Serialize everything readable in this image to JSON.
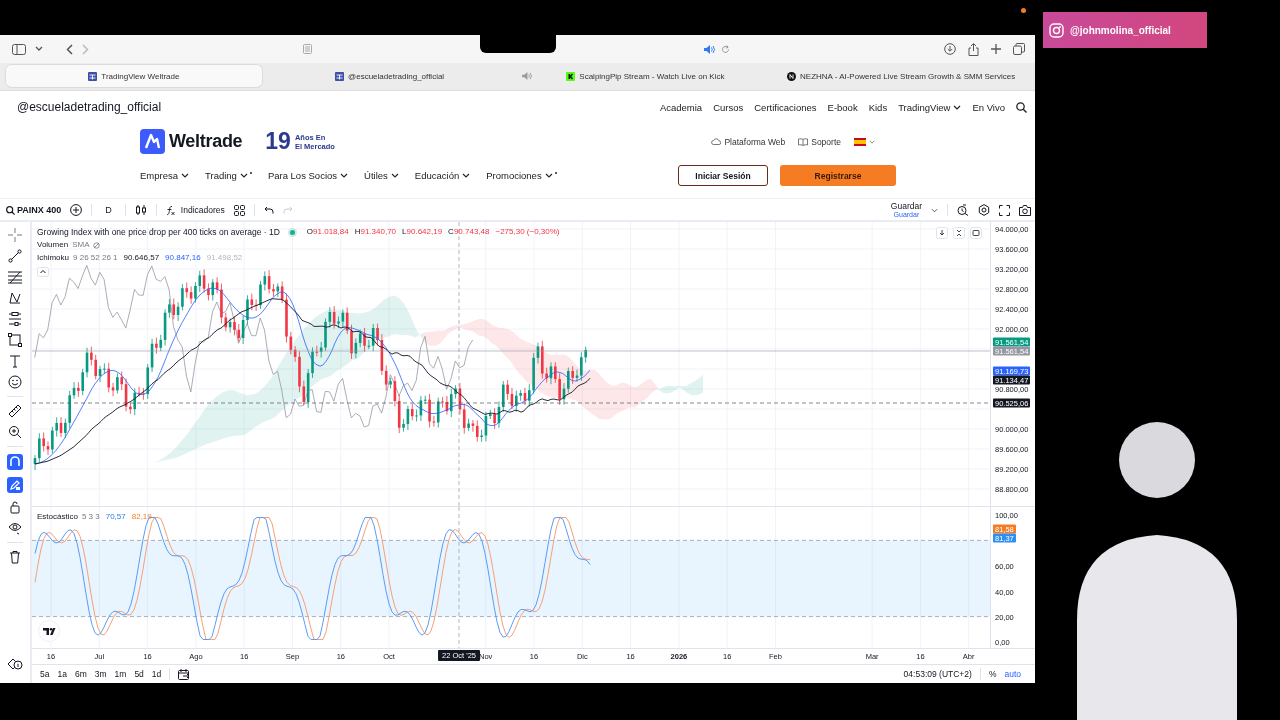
{
  "browser": {
    "tabs": [
      {
        "label": "TradingView Weltrade",
        "selected": true,
        "playing_audio": false
      },
      {
        "label": "@escueladetrading_official",
        "selected": false,
        "playing_audio": false
      },
      {
        "label": "ScalpingPip Stream - Watch Live on Kick",
        "selected": false,
        "playing_audio": true
      },
      {
        "label": "NEZHNA - AI-Powered Live Stream Growth & SMM Services",
        "selected": false,
        "playing_audio": false
      }
    ]
  },
  "site": {
    "handle": "@escueladetrading_official",
    "nav": [
      {
        "label": "Academia",
        "dropdown": false
      },
      {
        "label": "Cursos",
        "dropdown": false
      },
      {
        "label": "Certificaciones",
        "dropdown": false
      },
      {
        "label": "E-book",
        "dropdown": false
      },
      {
        "label": "Kids",
        "dropdown": false
      },
      {
        "label": "TradingView",
        "dropdown": true
      },
      {
        "label": "En Vivo",
        "dropdown": false
      }
    ],
    "brand": "Weltrade",
    "years": "19",
    "years_caption": [
      "Años En",
      "El Mercado"
    ],
    "links": [
      "Plataforma Web",
      "Soporte"
    ],
    "menu": [
      {
        "label": "Empresa",
        "dot": false
      },
      {
        "label": "Trading",
        "dot": true
      },
      {
        "label": "Para Los Socios",
        "dot": false
      },
      {
        "label": "Útiles",
        "dot": false
      },
      {
        "label": "Educación",
        "dot": false
      },
      {
        "label": "Promociones",
        "dot": true
      }
    ],
    "login": "Iniciar Sesión",
    "register": "Registrarse"
  },
  "chart": {
    "symbol": "PAINX 400",
    "interval": "D",
    "indicators": "Indicadores",
    "save": "Guardar",
    "save_caption": "Guardar",
    "title": "Growing Index with one price drop per 400 ticks on average · 1D",
    "ohlc": [
      {
        "label": "O",
        "value": "91.018,84"
      },
      {
        "label": "H",
        "value": "91.340,70"
      },
      {
        "label": "L",
        "value": "90.642,19"
      },
      {
        "label": "C",
        "value": "90.743,48"
      }
    ],
    "change": "−275,30 (−0,30%)",
    "volume": {
      "name": "Volumen",
      "param": "SMA"
    },
    "ichimoku": {
      "name": "Ichimoku",
      "params": "9 26 52 26 1",
      "values": [
        "90.646,57",
        "90.847,16",
        "91.498,52"
      ]
    },
    "price_axis": [
      {
        "kind": "tick",
        "text": "94.000,00"
      },
      {
        "kind": "tick",
        "text": "93.600,00"
      },
      {
        "kind": "tick",
        "text": "93.200,00"
      },
      {
        "kind": "tick",
        "text": "92.800,00"
      },
      {
        "kind": "tick",
        "text": "92.400,00"
      },
      {
        "kind": "tick",
        "text": "92.000,00"
      },
      {
        "kind": "label",
        "text": "91.561,54",
        "color": "#089981"
      },
      {
        "kind": "label",
        "text": "91.561,54",
        "color": "#9598a1"
      },
      {
        "kind": "label",
        "text": "91.169,73",
        "color": "#2962ff"
      },
      {
        "kind": "label",
        "text": "91.134,47",
        "color": "#131722"
      },
      {
        "kind": "tick",
        "text": "90.800,00"
      },
      {
        "kind": "label",
        "text": "90.525,06",
        "color": "#131722"
      },
      {
        "kind": "tick",
        "text": "90.000,00"
      },
      {
        "kind": "tick",
        "text": "89.600,00"
      },
      {
        "kind": "tick",
        "text": "89.200,00"
      },
      {
        "kind": "tick",
        "text": "88.800,00"
      }
    ],
    "stochastic": {
      "name": "Estocástico",
      "params": "5 3 3",
      "values": [
        "70,57",
        "82,19"
      ]
    },
    "stoch_axis": [
      {
        "kind": "tick",
        "text": "100,00"
      },
      {
        "kind": "label",
        "text": "81,58",
        "color": "#f57c22"
      },
      {
        "kind": "label",
        "text": "81,37",
        "color": "#2f8ff0"
      },
      {
        "kind": "tick",
        "text": "60,00"
      },
      {
        "kind": "tick",
        "text": "40,00"
      },
      {
        "kind": "tick",
        "text": "20,00"
      },
      {
        "kind": "tick",
        "text": "0,00"
      }
    ],
    "time_axis": [
      {
        "label": "16",
        "bold": false
      },
      {
        "label": "Jul",
        "bold": false
      },
      {
        "label": "16",
        "bold": false
      },
      {
        "label": "Ago",
        "bold": false
      },
      {
        "label": "16",
        "bold": false
      },
      {
        "label": "Sep",
        "bold": false
      },
      {
        "label": "16",
        "bold": false
      },
      {
        "label": "Oct",
        "bold": false
      },
      {
        "label": "Nov",
        "bold": false
      },
      {
        "label": "16",
        "bold": false
      },
      {
        "label": "Dic",
        "bold": false
      },
      {
        "label": "16",
        "bold": false
      },
      {
        "label": "2026",
        "bold": true
      },
      {
        "label": "16",
        "bold": false
      },
      {
        "label": "Feb",
        "bold": false
      },
      {
        "label": "Mar",
        "bold": false
      },
      {
        "label": "16",
        "bold": false
      },
      {
        "label": "Abr",
        "bold": false
      }
    ],
    "crosshair_date": "22 Oct '25",
    "ranges": [
      "5a",
      "1a",
      "6m",
      "3m",
      "1m",
      "5d",
      "1d"
    ],
    "clock": "04:53:09 (UTC+2)",
    "percent": "%",
    "auto": "auto"
  },
  "overlay": {
    "instagram": "@johnmolina_official"
  }
}
